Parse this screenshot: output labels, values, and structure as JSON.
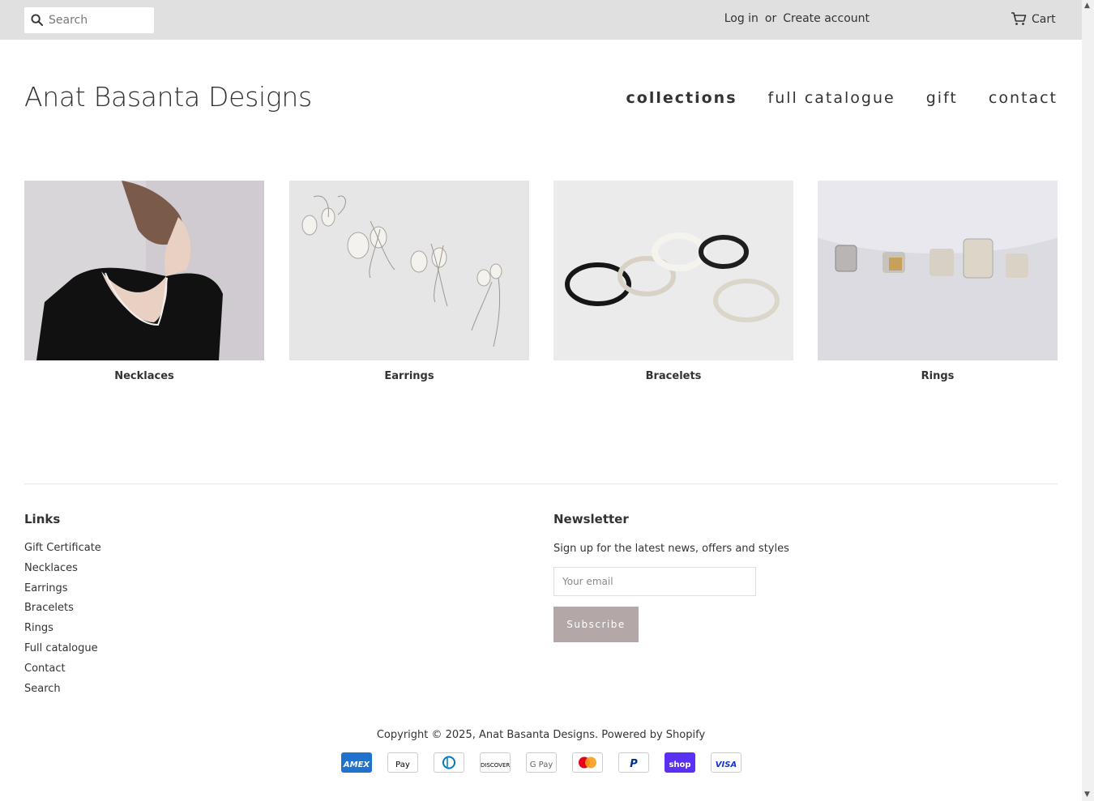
{
  "topbar": {
    "search_placeholder": "Search",
    "login_label": "Log in",
    "or_label": "or",
    "create_account_label": "Create account",
    "cart_label": "Cart"
  },
  "header": {
    "site_title": "Anat Basanta Designs",
    "nav": [
      {
        "label": "collections",
        "active": true
      },
      {
        "label": "full catalogue",
        "active": false
      },
      {
        "label": "gift",
        "active": false
      },
      {
        "label": "contact",
        "active": false
      }
    ]
  },
  "collections": [
    {
      "title": "Necklaces"
    },
    {
      "title": "Earrings"
    },
    {
      "title": "Bracelets"
    },
    {
      "title": "Rings"
    }
  ],
  "footer": {
    "links_heading": "Links",
    "links": [
      "Gift Certificate",
      "Necklaces",
      "Earrings",
      "Bracelets",
      "Rings",
      "Full catalogue",
      "Contact",
      "Search"
    ],
    "newsletter_heading": "Newsletter",
    "newsletter_text": "Sign up for the latest news, offers and styles",
    "email_placeholder": "Your email",
    "subscribe_label": "Subscribe",
    "copyright_prefix": "Copyright © 2025,",
    "copyright_store": "Anat Basanta Designs",
    "copyright_powered": ". Powered by Shopify",
    "payment_methods": [
      {
        "name": "American Express",
        "text": "AMEX",
        "icon": "amex-icon",
        "bg": "#1f72cd",
        "fg": "#ffffff",
        "outlined": false
      },
      {
        "name": "Apple Pay",
        "text": "Pay",
        "icon": "apple-pay-icon",
        "bg": "#ffffff",
        "fg": "#000000",
        "outlined": true
      },
      {
        "name": "Diners Club",
        "text": "",
        "icon": "diners-club-icon",
        "bg": "#ffffff",
        "fg": "#0079be",
        "outlined": true
      },
      {
        "name": "Discover",
        "text": "DISCOVER",
        "icon": "discover-icon",
        "bg": "#ffffff",
        "fg": "#000000",
        "outlined": true
      },
      {
        "name": "Google Pay",
        "text": "G Pay",
        "icon": "google-pay-icon",
        "bg": "#ffffff",
        "fg": "#5f6368",
        "outlined": true
      },
      {
        "name": "Mastercard",
        "text": "",
        "icon": "mastercard-icon",
        "bg": "#ffffff",
        "fg": "#eb001b",
        "outlined": true
      },
      {
        "name": "PayPal",
        "text": "P",
        "icon": "paypal-icon",
        "bg": "#ffffff",
        "fg": "#003087",
        "outlined": true
      },
      {
        "name": "Shop Pay",
        "text": "shop",
        "icon": "shop-pay-icon",
        "bg": "#5a31f4",
        "fg": "#ffffff",
        "outlined": false
      },
      {
        "name": "Visa",
        "text": "VISA",
        "icon": "visa-icon",
        "bg": "#ffffff",
        "fg": "#1434cb",
        "outlined": true
      }
    ]
  },
  "colors": {
    "topbar_bg": "#e0e0e0",
    "text": "#333333",
    "subscribe_bg": "#b4a7a8",
    "divider": "#e4e4e4"
  }
}
